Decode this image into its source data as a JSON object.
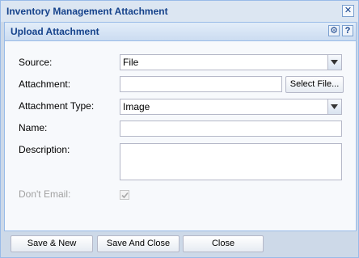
{
  "window": {
    "title": "Inventory Management Attachment",
    "close_symbol": "✕"
  },
  "panel": {
    "title": "Upload Attachment",
    "tools": [
      {
        "name": "gear-icon",
        "symbol": "⚙"
      },
      {
        "name": "help-icon",
        "symbol": "?"
      }
    ]
  },
  "form": {
    "source": {
      "label": "Source:",
      "value": "File"
    },
    "attachment": {
      "label": "Attachment:",
      "value": "",
      "button": "Select File..."
    },
    "attachment_type": {
      "label": "Attachment Type:",
      "value": "Image"
    },
    "name": {
      "label": "Name:",
      "value": ""
    },
    "description": {
      "label": "Description:",
      "value": ""
    },
    "dont_email": {
      "label": "Don't Email:",
      "checked": true,
      "disabled": true
    }
  },
  "footer": {
    "buttons": [
      "Save & New",
      "Save And Close",
      "Close"
    ]
  },
  "colors": {
    "title_text": "#15428b",
    "window_bg": "#cdd9e8",
    "panel_border": "#99bbe8"
  }
}
